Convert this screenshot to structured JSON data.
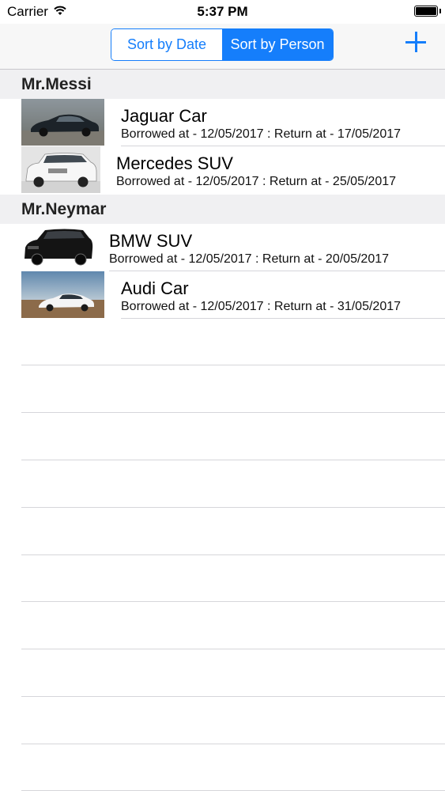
{
  "status_bar": {
    "carrier": "Carrier",
    "time": "5:37 PM"
  },
  "nav": {
    "segments": [
      {
        "label": "Sort by Date",
        "selected": false
      },
      {
        "label": "Sort by Person",
        "selected": true
      }
    ],
    "add_icon": "plus-icon",
    "accent": "#157efb"
  },
  "sections": [
    {
      "header": "Mr.Messi",
      "rows": [
        {
          "title": "Jaguar Car",
          "subtitle": "Borrowed at - 12/05/2017 : Return at - 17/05/2017",
          "thumb": "dark-sedan-image"
        },
        {
          "title": "Mercedes SUV",
          "subtitle": "Borrowed at - 12/05/2017 : Return at - 25/05/2017",
          "thumb": "white-suv-image"
        }
      ]
    },
    {
      "header": "Mr.Neymar",
      "rows": [
        {
          "title": "BMW SUV",
          "subtitle": "Borrowed at - 12/05/2017 : Return at - 20/05/2017",
          "thumb": "black-suv-image"
        },
        {
          "title": "Audi Car",
          "subtitle": "Borrowed at - 12/05/2017 : Return at - 31/05/2017",
          "thumb": "white-sportback-image"
        }
      ]
    }
  ]
}
